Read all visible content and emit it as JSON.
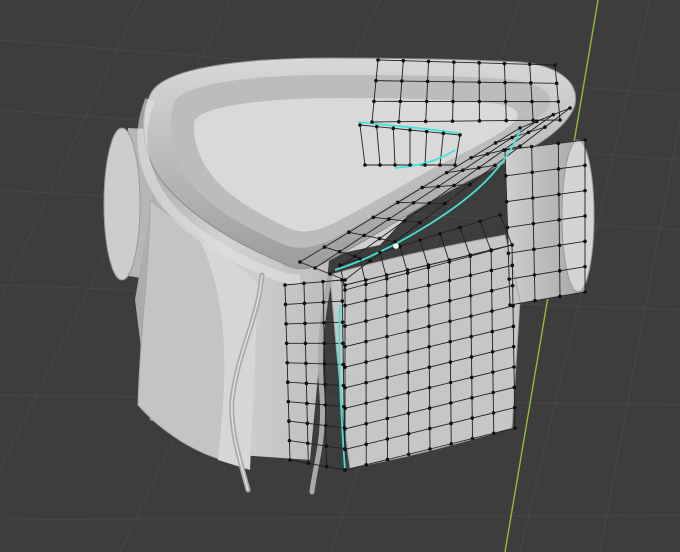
{
  "viewport": {
    "background_color": "#3d3d3d",
    "grid_color": "#4a4a4a",
    "axis_color": "#8dbf2e"
  },
  "mesh": {
    "object": "hoodie-mesh",
    "body_color": "#c9c9c9",
    "shadow_color": "#8f8f8f",
    "interior_color": "#5a5a56",
    "wire_color": "#202020",
    "vertex_color": "#101010",
    "selected_edge_color": "#3ee6d8",
    "active_vertex_color": "#ffffff"
  },
  "icons": {
    "vertex": "vertex-dot-icon"
  }
}
